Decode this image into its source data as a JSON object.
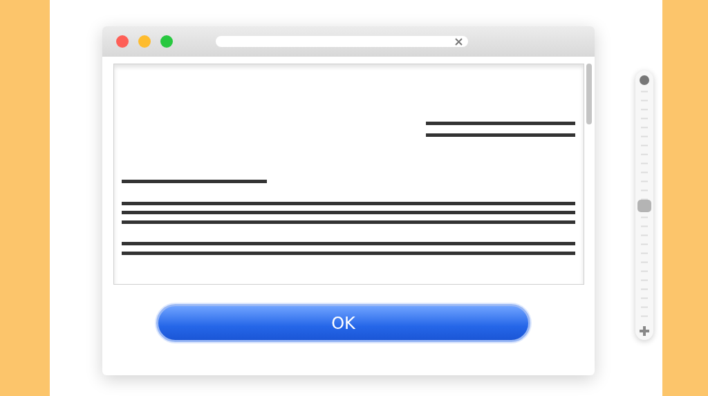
{
  "window": {
    "title_field": {
      "placeholder_shown": true
    }
  },
  "zoom_slider": {
    "level": 0.5
  },
  "button": {
    "label": "OK"
  }
}
